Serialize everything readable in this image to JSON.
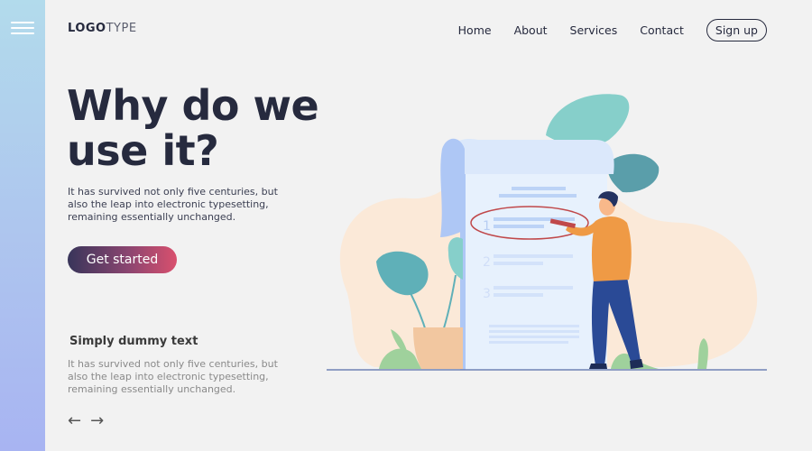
{
  "sidebar": {
    "menu_icon": "hamburger-icon"
  },
  "header": {
    "logo_bold": "LOGO",
    "logo_light": "TYPE",
    "nav": [
      {
        "label": "Home"
      },
      {
        "label": "About"
      },
      {
        "label": "Services"
      },
      {
        "label": "Contact"
      }
    ],
    "signup_label": "Sign up"
  },
  "hero": {
    "title_line1": "Why do we",
    "title_line2": "use it?",
    "text": "It has survived not only five centuries, but also the leap into electronic typesetting, remaining essentially unchanged.",
    "cta_label": "Get started"
  },
  "secondary": {
    "title": "Simply dummy text",
    "text": "It has survived not only five centuries, but also the leap into electronic typesetting, remaining essentially unchanged.",
    "prev_icon": "←",
    "next_icon": "→"
  },
  "illustration": {
    "list_numbers": [
      "1",
      "2",
      "3"
    ],
    "colors": {
      "blob": "#fbe9d8",
      "paper": "#e7f1fd",
      "paper_roll": "#aec7f5",
      "leaf_light": "#86cfca",
      "leaf_dark": "#5a9eaa",
      "shirt": "#ef9a45",
      "pants": "#2a4a96",
      "circle": "#c0484a",
      "ground": "#6f82b5"
    }
  }
}
